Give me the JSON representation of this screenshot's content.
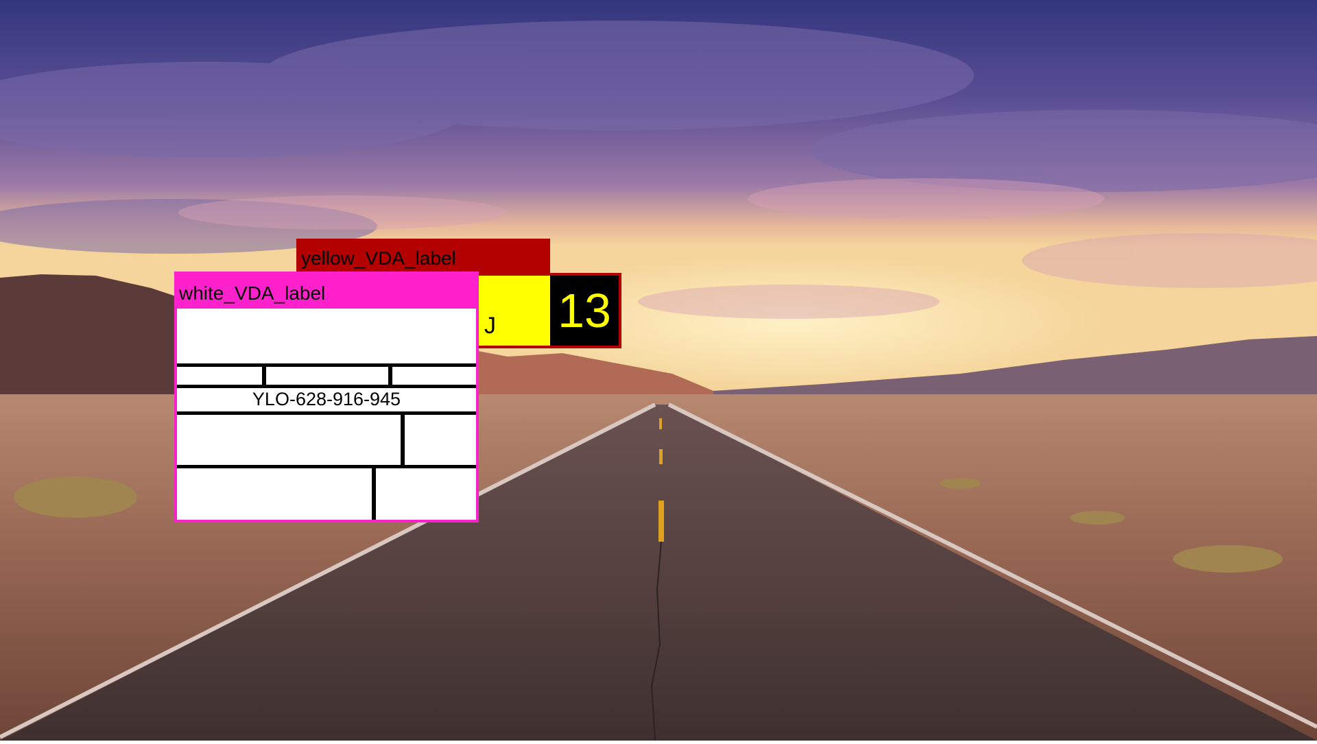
{
  "yellow_window": {
    "title": "yellow_VDA_label",
    "letter": "J",
    "number": "13",
    "colors": {
      "title_bar": "#b30000",
      "body": "#ffff00",
      "number_bg": "#000000",
      "number_fg": "#ffff00"
    }
  },
  "white_window": {
    "title": "white_VDA_label",
    "code": "YLO-628-916-945",
    "colors": {
      "frame": "#ff22cc",
      "body": "#ffffff"
    }
  },
  "background": {
    "colors": {
      "sky_top": "#3a3f8f",
      "sky_mid": "#8e6a9a",
      "horizon": "#f3c98a",
      "ground": "#8a5a48",
      "road": "#4a3a3a"
    }
  }
}
